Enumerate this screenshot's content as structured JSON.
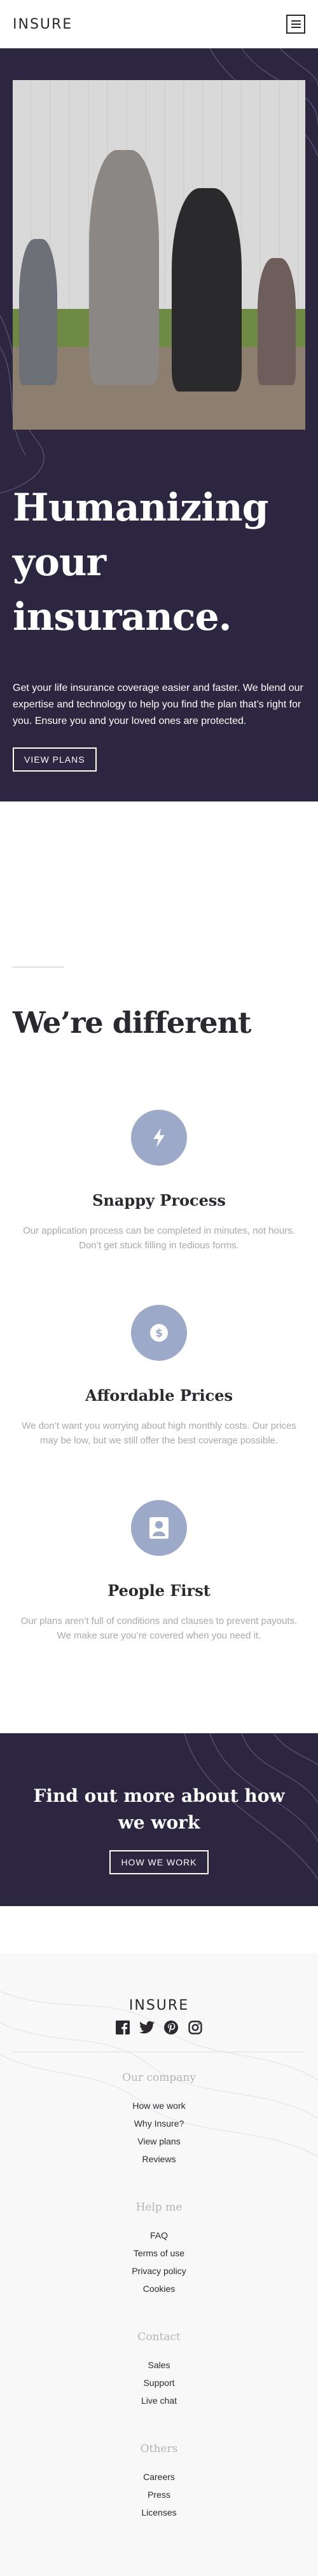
{
  "brand": {
    "name": "INSURE"
  },
  "header": {
    "menu_icon": "hamburger-menu-icon"
  },
  "hero": {
    "title": "Humanizing your insurance.",
    "description": "Get your life insurance coverage easier and faster. We blend our expertise and technology to help you find the plan that’s right for you. Ensure you and your loved ones are protected.",
    "button_label": "VIEW PLANS",
    "image_alt": "Family of four walking hand in hand"
  },
  "different": {
    "title": "We’re different",
    "features": [
      {
        "icon": "lightning-bolt-icon",
        "title": "Snappy Process",
        "text": "Our application process can be completed in minutes, not hours. Don’t get stuck filling in tedious forms."
      },
      {
        "icon": "dollar-coin-icon",
        "title": "Affordable Prices",
        "text": "We don’t want you worrying about high monthly costs. Our prices may be low, but we still offer the best coverage possible."
      },
      {
        "icon": "person-icon",
        "title": "People First",
        "text": "Our plans aren’t full of conditions and clauses to prevent payouts. We make sure you’re covered when you need it."
      }
    ]
  },
  "cta": {
    "title": "Find out more about how we work",
    "button_label": "HOW WE WORK"
  },
  "footer": {
    "logo": "INSURE",
    "socials": [
      "facebook-icon",
      "twitter-icon",
      "pinterest-icon",
      "instagram-icon"
    ],
    "columns": [
      {
        "heading": "Our company",
        "links": [
          "How we work",
          "Why Insure?",
          "View plans",
          "Reviews"
        ]
      },
      {
        "heading": "Help me",
        "links": [
          "FAQ",
          "Terms of use",
          "Privacy policy",
          "Cookies"
        ]
      },
      {
        "heading": "Contact",
        "links": [
          "Sales",
          "Support",
          "Live chat"
        ]
      },
      {
        "heading": "Others",
        "links": [
          "Careers",
          "Press",
          "Licenses"
        ]
      }
    ]
  },
  "colors": {
    "dark_violet": "#2c2641",
    "grayish_blue": "#9ca9c9",
    "very_light_gray": "#f8f8f8"
  }
}
